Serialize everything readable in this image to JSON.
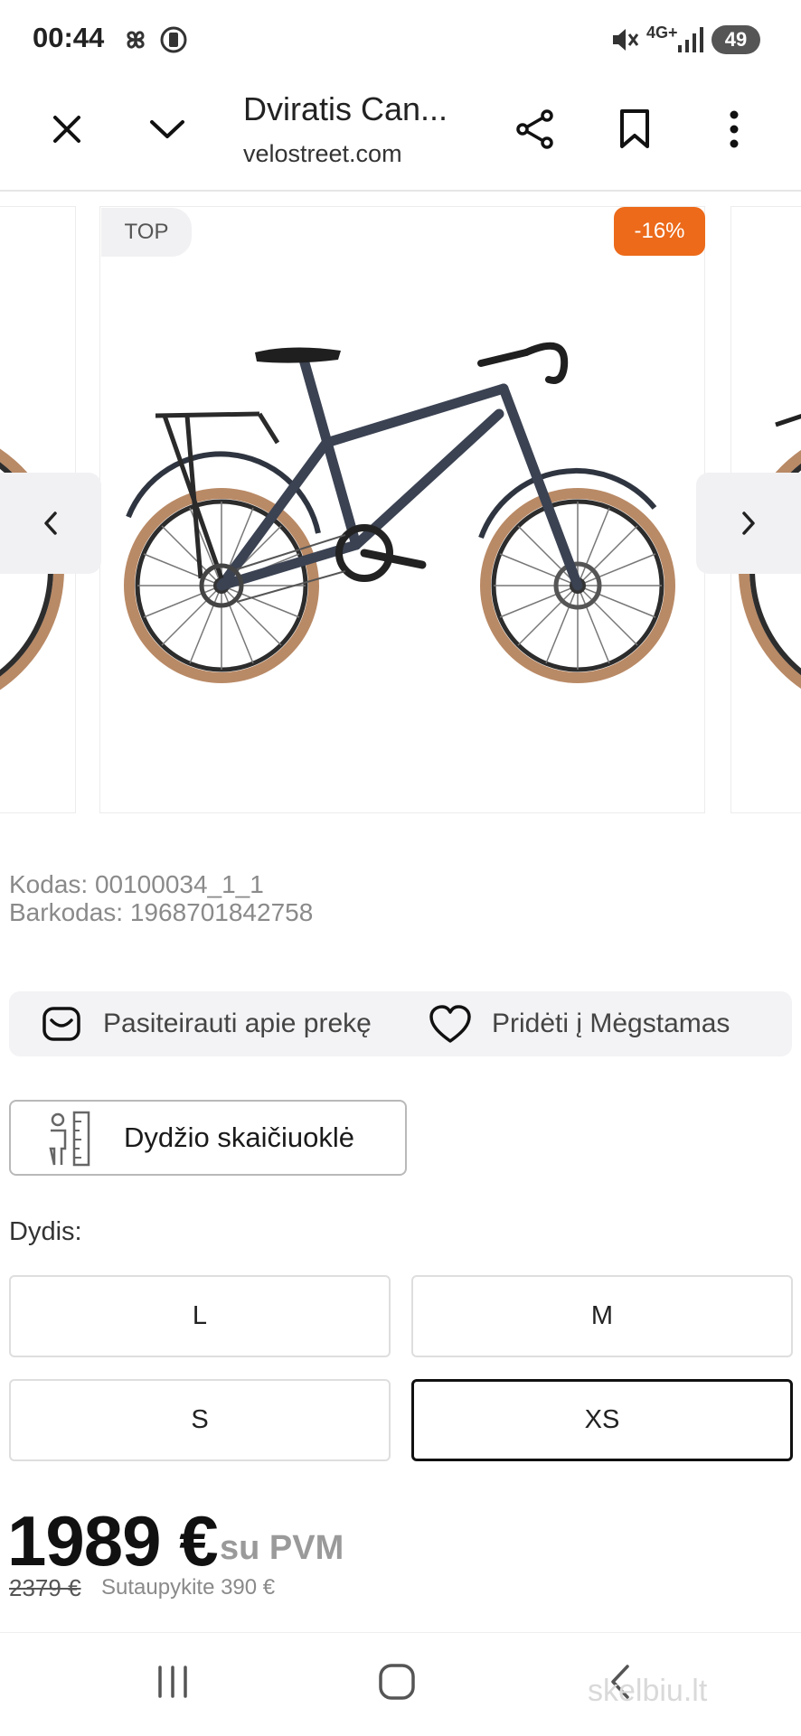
{
  "status_bar": {
    "time": "00:44",
    "network": "4G+",
    "battery": "49",
    "icons": [
      "pinwheel-icon",
      "battery-saver-icon",
      "mute-icon",
      "signal-icon"
    ]
  },
  "browser": {
    "title": "Dviratis Can...",
    "domain": "velostreet.com",
    "buttons": [
      "close-icon",
      "chevron-down-icon",
      "share-icon",
      "bookmark-icon",
      "more-icon"
    ]
  },
  "product": {
    "badge_top": "TOP",
    "badge_discount": "-16%",
    "code_line": "Kodas: 00100034_1_1",
    "barcode_line": "Barkodas: 1968701842758",
    "inquire_label": "Pasiteirauti apie prekę",
    "favorite_label": "Pridėti į Mėgstamas",
    "size_calculator_label": "Dydžio skaičiuoklė",
    "size_label": "Dydis:",
    "sizes": [
      "L",
      "M",
      "S",
      "XS"
    ],
    "selected_size": "XS",
    "price": "1989 €",
    "price_vat": "su PVM",
    "old_price": "2379 €",
    "savings": "Sutaupykite 390 €"
  },
  "colors": {
    "discount": "#ec6a1a",
    "tire_wall": "#b98a66",
    "frame": "#3b4252"
  },
  "watermark": "skelbiu.lt"
}
